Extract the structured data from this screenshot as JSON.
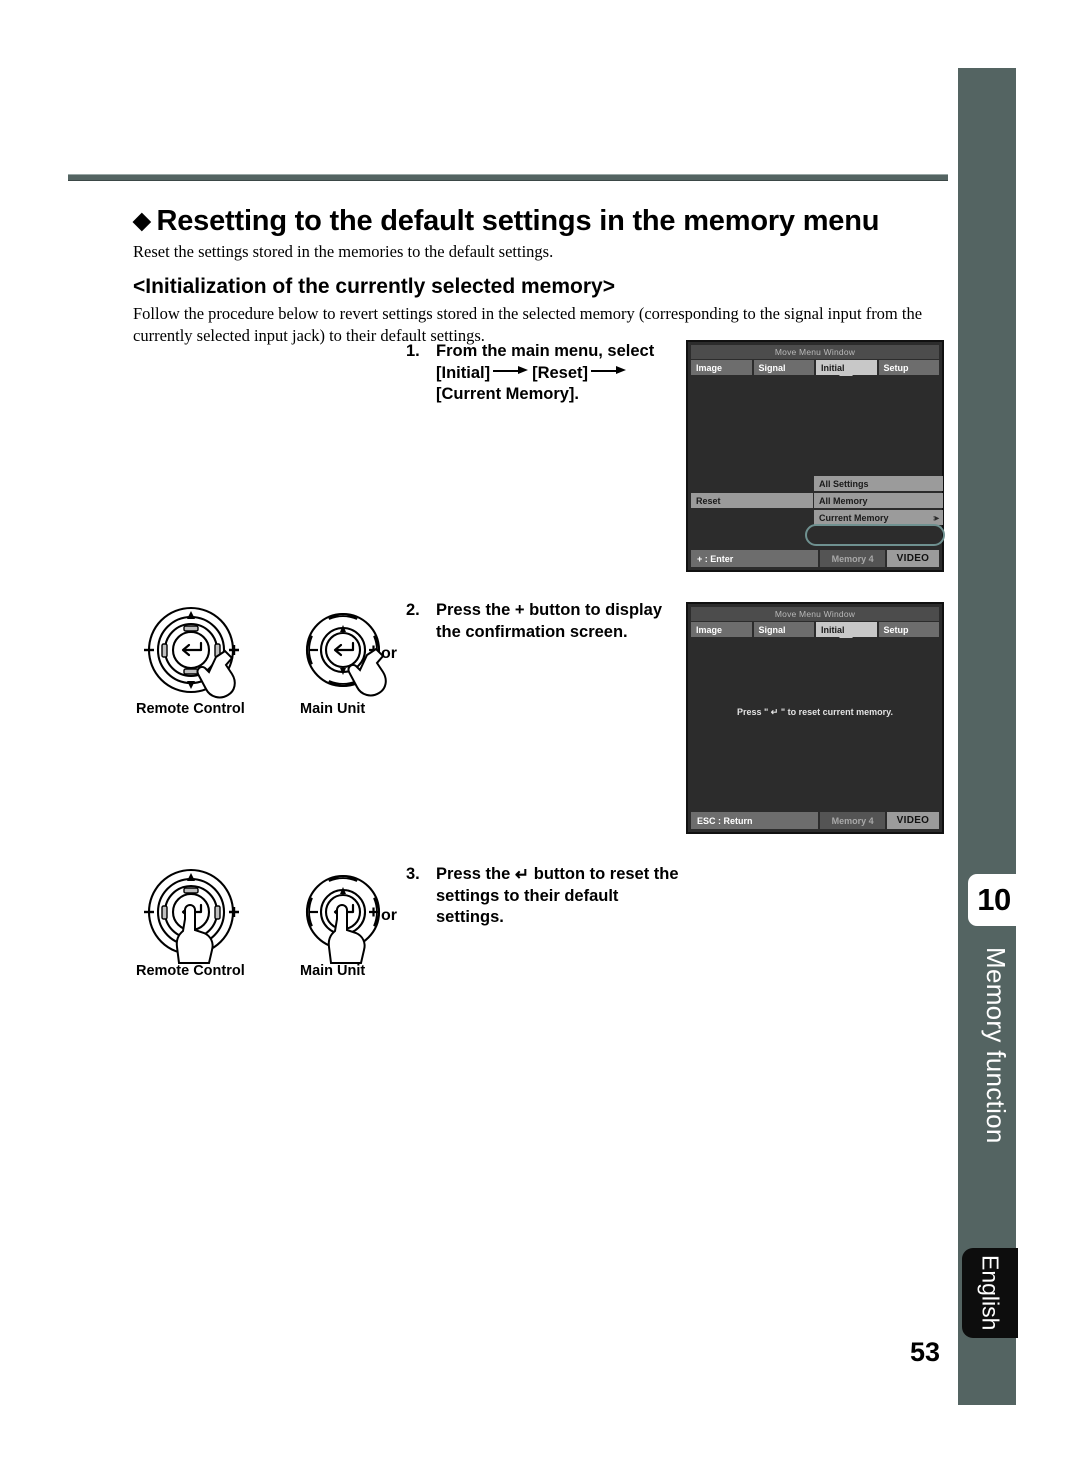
{
  "page": {
    "folio": "53",
    "language_tab": "English",
    "chapter_number": "10",
    "chapter_label": "Memory function"
  },
  "header": {
    "diamond": "◆",
    "heading": "Resetting to the default settings in the memory menu",
    "intro": "Reset the settings stored in the memories to the default settings.",
    "subheading": "<Initialization of the currently selected memory>",
    "lead": "Follow the procedure below to revert settings stored in the selected memory (corresponding to the signal input from the currently selected input jack) to their default settings."
  },
  "steps": [
    {
      "number": "1.",
      "text_part1": "From the main menu, select [Initial]",
      "text_part2": "[Reset]",
      "text_part3": "[Current Memory]."
    },
    {
      "number": "2.",
      "text": "Press the + button to display the confirmation screen."
    },
    {
      "number": "3.",
      "text_part1": "Press the",
      "enter_glyph": "↵",
      "text_part2": "button to reset the settings to their default settings."
    }
  ],
  "osd_screens": [
    {
      "title": "Move Menu Window",
      "tabs": [
        "Image",
        "Signal",
        "Initial",
        "Setup"
      ],
      "active_tab": "Initial",
      "menu_label": "Reset",
      "submenu": [
        {
          "label": "All Settings",
          "adjust": ""
        },
        {
          "label": "All Memory",
          "adjust": ""
        },
        {
          "label": "Current Memory",
          "adjust": "↕▸"
        }
      ],
      "highlighted_item": "Current Memory",
      "status_left": "+ : Enter",
      "status_middle": "Memory 4",
      "status_right": "VIDEO"
    },
    {
      "title": "Move Menu Window",
      "tabs": [
        "Image",
        "Signal",
        "Initial",
        "Setup"
      ],
      "active_tab": "Initial",
      "message": "Press \" ↵ \" to reset current memory.",
      "status_left": "ESC : Return",
      "status_middle": "Memory 4",
      "status_right": "VIDEO"
    }
  ],
  "control_illustrations": [
    {
      "or_text": "or",
      "caption_remote": "Remote Control",
      "caption_main": "Main Unit",
      "pressed_button": "plus"
    },
    {
      "or_text": "or",
      "caption_remote": "Remote Control",
      "caption_main": "Main Unit",
      "pressed_button": "enter"
    }
  ],
  "colors": {
    "rail": "#546462",
    "rule": "#546462",
    "highlight_ring": "#6f9190",
    "language_tab_bg": "#0d0d0d"
  }
}
